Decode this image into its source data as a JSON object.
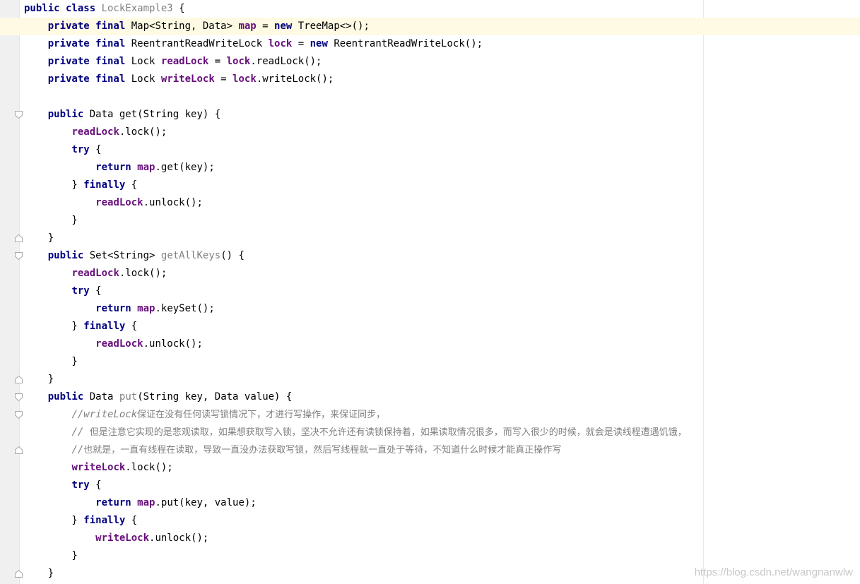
{
  "editor": {
    "lines": [
      [
        {
          "t": "public class ",
          "c": "kw"
        },
        {
          "t": "LockExample3",
          "c": "unused"
        },
        {
          "t": " {"
        }
      ],
      [
        {
          "t": "    "
        },
        {
          "t": "private final ",
          "c": "kw"
        },
        {
          "t": "Map<String, Data> "
        },
        {
          "t": "map",
          "c": "fld"
        },
        {
          "t": " = "
        },
        {
          "t": "new ",
          "c": "kw"
        },
        {
          "t": "TreeMap<>();"
        }
      ],
      [
        {
          "t": "    "
        },
        {
          "t": "private final ",
          "c": "kw"
        },
        {
          "t": "ReentrantReadWriteLock "
        },
        {
          "t": "lock",
          "c": "fld"
        },
        {
          "t": " = "
        },
        {
          "t": "new ",
          "c": "kw"
        },
        {
          "t": "ReentrantReadWriteLock();"
        }
      ],
      [
        {
          "t": "    "
        },
        {
          "t": "private final ",
          "c": "kw"
        },
        {
          "t": "Lock "
        },
        {
          "t": "readLock",
          "c": "fld"
        },
        {
          "t": " = "
        },
        {
          "t": "lock",
          "c": "fld"
        },
        {
          "t": ".readLock();"
        }
      ],
      [
        {
          "t": "    "
        },
        {
          "t": "private final ",
          "c": "kw"
        },
        {
          "t": "Lock "
        },
        {
          "t": "writeLock",
          "c": "fld"
        },
        {
          "t": " = "
        },
        {
          "t": "lock",
          "c": "fld"
        },
        {
          "t": ".writeLock();"
        }
      ],
      [],
      [
        {
          "t": "    "
        },
        {
          "t": "public ",
          "c": "kw"
        },
        {
          "t": "Data get(String key) {"
        }
      ],
      [
        {
          "t": "        "
        },
        {
          "t": "readLock",
          "c": "fld"
        },
        {
          "t": ".lock();"
        }
      ],
      [
        {
          "t": "        "
        },
        {
          "t": "try ",
          "c": "kw"
        },
        {
          "t": "{"
        }
      ],
      [
        {
          "t": "            "
        },
        {
          "t": "return ",
          "c": "kw"
        },
        {
          "t": "map",
          "c": "fld"
        },
        {
          "t": ".get(key);"
        }
      ],
      [
        {
          "t": "        } "
        },
        {
          "t": "finally ",
          "c": "kw"
        },
        {
          "t": "{"
        }
      ],
      [
        {
          "t": "            "
        },
        {
          "t": "readLock",
          "c": "fld"
        },
        {
          "t": ".unlock();"
        }
      ],
      [
        {
          "t": "        }"
        }
      ],
      [
        {
          "t": "    }"
        }
      ],
      [
        {
          "t": "    "
        },
        {
          "t": "public ",
          "c": "kw"
        },
        {
          "t": "Set<String> "
        },
        {
          "t": "getAllKeys",
          "c": "unused"
        },
        {
          "t": "() {"
        }
      ],
      [
        {
          "t": "        "
        },
        {
          "t": "readLock",
          "c": "fld"
        },
        {
          "t": ".lock();"
        }
      ],
      [
        {
          "t": "        "
        },
        {
          "t": "try ",
          "c": "kw"
        },
        {
          "t": "{"
        }
      ],
      [
        {
          "t": "            "
        },
        {
          "t": "return ",
          "c": "kw"
        },
        {
          "t": "map",
          "c": "fld"
        },
        {
          "t": ".keySet();"
        }
      ],
      [
        {
          "t": "        } "
        },
        {
          "t": "finally ",
          "c": "kw"
        },
        {
          "t": "{"
        }
      ],
      [
        {
          "t": "            "
        },
        {
          "t": "readLock",
          "c": "fld"
        },
        {
          "t": ".unlock();"
        }
      ],
      [
        {
          "t": "        }"
        }
      ],
      [
        {
          "t": "    }"
        }
      ],
      [
        {
          "t": "    "
        },
        {
          "t": "public ",
          "c": "kw"
        },
        {
          "t": "Data "
        },
        {
          "t": "put",
          "c": "unused"
        },
        {
          "t": "(String key, Data value) {"
        }
      ],
      [
        {
          "t": "        "
        },
        {
          "t": "//writeLock",
          "c": "cmt"
        },
        {
          "t": "保证在没有任何读写锁情况下，才进行写操作，来保证同步，",
          "c": "cjk"
        }
      ],
      [
        {
          "t": "        "
        },
        {
          "t": "// ",
          "c": "cmt"
        },
        {
          "t": "但是注意它实现的是悲观读取，如果想获取写入锁，坚决不允许还有读锁保持着，如果读取情况很多，而写入很少的时候，就会是读线程遭遇饥饿，",
          "c": "cjk"
        }
      ],
      [
        {
          "t": "        "
        },
        {
          "t": "//",
          "c": "cmt"
        },
        {
          "t": "也就是，一直有线程在读取，导致一直没办法获取写锁，然后写线程就一直处于等待，不知道什么时候才能真正操作写",
          "c": "cjk"
        }
      ],
      [
        {
          "t": "        "
        },
        {
          "t": "writeLock",
          "c": "fld"
        },
        {
          "t": ".lock();"
        }
      ],
      [
        {
          "t": "        "
        },
        {
          "t": "try ",
          "c": "kw"
        },
        {
          "t": "{"
        }
      ],
      [
        {
          "t": "            "
        },
        {
          "t": "return ",
          "c": "kw"
        },
        {
          "t": "map",
          "c": "fld"
        },
        {
          "t": ".put(key, value);"
        }
      ],
      [
        {
          "t": "        } "
        },
        {
          "t": "finally ",
          "c": "kw"
        },
        {
          "t": "{"
        }
      ],
      [
        {
          "t": "            "
        },
        {
          "t": "writeLock",
          "c": "fld"
        },
        {
          "t": ".unlock();"
        }
      ],
      [
        {
          "t": "        }"
        }
      ],
      [
        {
          "t": "    }"
        }
      ]
    ],
    "highlighted_line": 1,
    "folds": [
      {
        "line": 6,
        "dir": "down"
      },
      {
        "line": 13,
        "dir": "up"
      },
      {
        "line": 14,
        "dir": "down"
      },
      {
        "line": 21,
        "dir": "up"
      },
      {
        "line": 22,
        "dir": "down"
      },
      {
        "line": 23,
        "dir": "down"
      },
      {
        "line": 25,
        "dir": "up"
      },
      {
        "line": 32,
        "dir": "up"
      }
    ]
  },
  "watermark": "https://blog.csdn.net/wangnanwlw"
}
